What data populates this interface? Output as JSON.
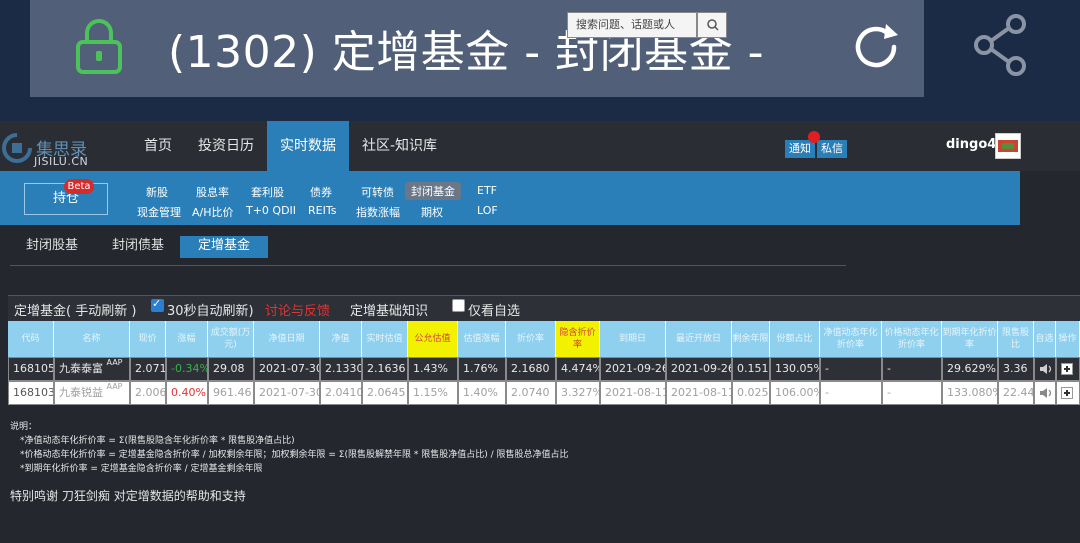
{
  "browser": {
    "url_text": "(1302) 定增基金 - 封闭基金 -",
    "lock_color": "#4cc35a"
  },
  "header": {
    "logo_cn": "集思录",
    "logo_en": "JISILU.CN",
    "nav": [
      "首页",
      "投资日历",
      "实时数据",
      "社区-知识库"
    ],
    "active_nav": "实时数据",
    "search_placeholder": "搜索问题、话题或人",
    "notify_label": "通知",
    "message_label": "私信",
    "username": "dingo49"
  },
  "subnav": {
    "hold_label": "持仓",
    "beta_label": "Beta",
    "row1": [
      "新股",
      "股息率",
      "套利股",
      "债券",
      "可转债",
      "封闭基金",
      "ETF"
    ],
    "row2": [
      "现金管理",
      "A/H比价",
      "T+0 QDII",
      "REITs",
      "指数涨幅",
      "期权",
      "LOF"
    ],
    "active": "封闭基金"
  },
  "tabs": {
    "items": [
      "封闭股基",
      "封闭债基",
      "定增基金"
    ],
    "active": "定增基金"
  },
  "toolbar": {
    "title": "定增基金( 手动刷新 )",
    "auto_refresh": "30秒自动刷新)",
    "auto_refresh_checked": true,
    "discuss": "讨论与反馈",
    "knowledge": "定增基础知识",
    "only_watch": "仅看自选",
    "only_watch_checked": false
  },
  "table": {
    "headers": [
      "代码",
      "名称",
      "现价",
      "涨幅",
      "成交额(万元)",
      "净值日期",
      "净值",
      "实时估值",
      "公允估值",
      "估值涨幅",
      "折价率",
      "隐含折价率",
      "到期日",
      "最近开放日",
      "剩余年限",
      "份额占比",
      "净值动态年化折价率",
      "价格动态年化折价率",
      "到期年化折价率",
      "限售股比",
      "自选",
      "操作"
    ],
    "yellow_headers": [
      "公允估值",
      "隐含折价率"
    ],
    "rows": [
      {
        "code": "168105",
        "name": "九泰泰富",
        "badge": "AAP",
        "price": "2.071",
        "change": "-0.34%",
        "volume": "29.08",
        "nav_date": "2021-07-30",
        "nav": "2.1330",
        "est": "2.1636",
        "fair": "1.43%",
        "est_change": "1.76%",
        "discount": "2.1680",
        "implied": "4.474%",
        "due": "2021-09-26",
        "open": "2021-09-26",
        "years": "0.151",
        "ratio": "130.05%",
        "c1": "-",
        "c2": "-",
        "c3": "29.629%",
        "c4": "3.36"
      },
      {
        "code": "168103",
        "name": "九泰锐益",
        "badge": "AAP",
        "price": "2.006",
        "change": "0.40%",
        "volume": "961.46",
        "nav_date": "2021-07-30",
        "nav": "2.0410",
        "est": "2.0645",
        "fair": "1.15%",
        "est_change": "1.40%",
        "discount": "2.0740",
        "implied": "3.327%",
        "due": "2021-08-11",
        "open": "2021-08-11",
        "years": "0.025",
        "ratio": "106.00%",
        "c1": "-",
        "c2": "-",
        "c3": "133.080%",
        "c4": "22.44"
      }
    ]
  },
  "notes": {
    "title": "说明：",
    "lines": [
      "*净值动态年化折价率 = Σ(限售股隐含年化折价率 * 限售股净值占比)",
      "*价格动态年化折价率 = 定增基金隐含折价率 / 加权剩余年限；加权剩余年限 = Σ(限售股解禁年限 * 限售股净值占比) / 限售股总净值占比",
      "*到期年化折价率 = 定增基金隐含折价率 / 定增基金剩余年限"
    ],
    "thanks_prefix": "特别鸣谢",
    "thanks_name": "刀狂剑痴",
    "thanks_suffix": "对定增数据的帮助和支持"
  },
  "colors": {
    "accent": "#2a7fb8",
    "header_cell": "#8fd0ee",
    "highlight": "#f2f200",
    "negative": "#37b24d",
    "positive": "#e03434"
  }
}
